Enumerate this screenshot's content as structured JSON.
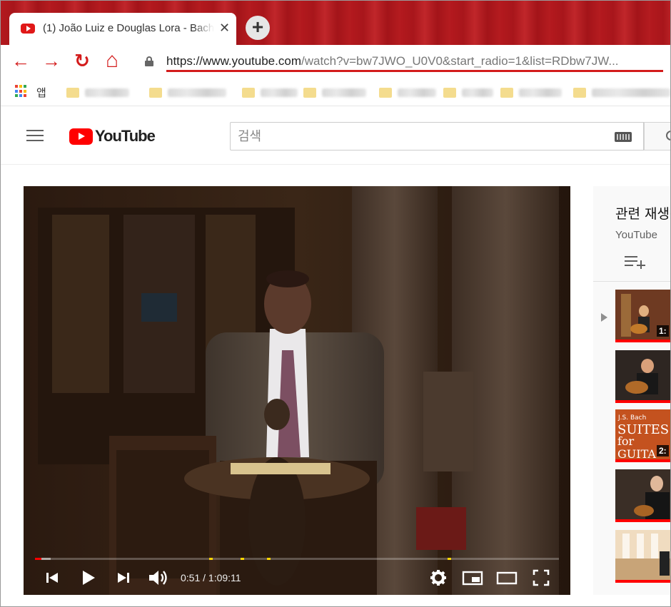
{
  "browser": {
    "tab": {
      "title": "(1) João Luiz e Douglas Lora - Bach",
      "close_glyph": "✕"
    },
    "new_tab_glyph": "+",
    "nav": {
      "back_glyph": "←",
      "forward_glyph": "→",
      "reload_glyph": "↻",
      "home_glyph": "⌂"
    },
    "url": {
      "host": "https://www.youtube.com",
      "path": "/watch?v=bw7JWO_U0V0&start_radio=1&list=RDbw7JW..."
    },
    "bookmarks": {
      "apps_label": "앱"
    }
  },
  "youtube": {
    "logo_text": "YouTube",
    "search": {
      "placeholder": "검색"
    }
  },
  "player": {
    "time_current": "0:51",
    "time_total": "1:09:11",
    "time_display": "0:51 / 1:09:11",
    "progress_fraction": 0.0123,
    "buffered_fraction": 0.03
  },
  "sidebar": {
    "title": "관련 재생목록",
    "subtitle": "YouTube",
    "thumbs": [
      {
        "duration": "1:"
      },
      {
        "duration": ""
      },
      {
        "duration": "2:",
        "text_lines": [
          "J.S. Bach",
          "SUITES",
          "for",
          "GUITA"
        ]
      },
      {
        "duration": ""
      },
      {
        "duration": ""
      }
    ]
  },
  "colors": {
    "accent_red": "#d31b1b",
    "youtube_red": "#ff0000",
    "tabstrip": "#b3191e"
  }
}
